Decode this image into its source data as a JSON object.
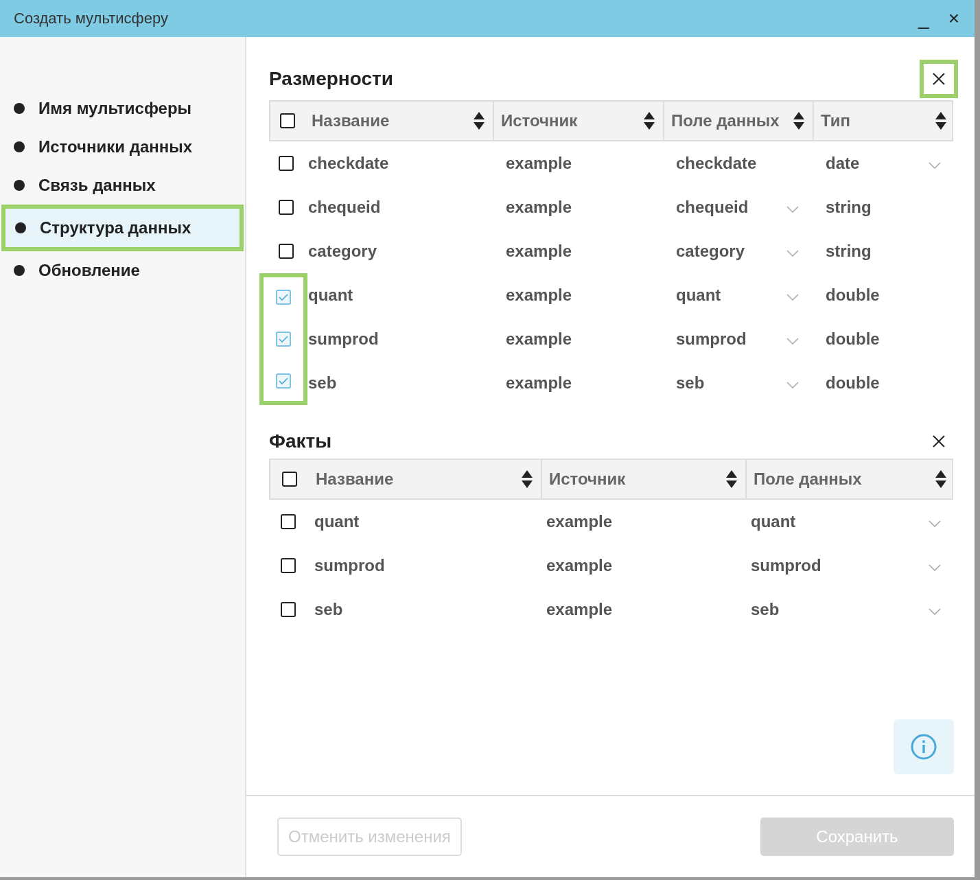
{
  "window": {
    "title": "Создать мультисферу",
    "controls": [
      "_",
      "×"
    ]
  },
  "sidebar": {
    "items": [
      {
        "label": "Имя мультисферы",
        "selected": false,
        "highlighted": false
      },
      {
        "label": "Источники данных",
        "selected": false,
        "highlighted": false
      },
      {
        "label": "Связь данных",
        "selected": false,
        "highlighted": false
      },
      {
        "label": "Структура данных",
        "selected": true,
        "highlighted": true
      },
      {
        "label": "Обновление",
        "selected": false,
        "highlighted": false
      }
    ]
  },
  "dimensions": {
    "title": "Размерности",
    "close_highlighted": true,
    "all_checked": false,
    "columns": [
      "Название",
      "Источник",
      "Поле данных",
      "Тип"
    ],
    "rows": [
      {
        "checked": false,
        "highlighted": false,
        "name": "checkdate",
        "source": "example",
        "field": "checkdate",
        "field_dropdown": false,
        "type": "date",
        "type_dropdown": true
      },
      {
        "checked": false,
        "highlighted": false,
        "name": "chequeid",
        "source": "example",
        "field": "chequeid",
        "field_dropdown": true,
        "type": "string",
        "type_dropdown": false
      },
      {
        "checked": false,
        "highlighted": false,
        "name": "category",
        "source": "example",
        "field": "category",
        "field_dropdown": true,
        "type": "string",
        "type_dropdown": false
      },
      {
        "checked": true,
        "highlighted": true,
        "name": "quant",
        "source": "example",
        "field": "quant",
        "field_dropdown": true,
        "type": "double",
        "type_dropdown": false
      },
      {
        "checked": true,
        "highlighted": true,
        "name": "sumprod",
        "source": "example",
        "field": "sumprod",
        "field_dropdown": true,
        "type": "double",
        "type_dropdown": false
      },
      {
        "checked": true,
        "highlighted": true,
        "name": "seb",
        "source": "example",
        "field": "seb",
        "field_dropdown": true,
        "type": "double",
        "type_dropdown": false
      }
    ]
  },
  "facts": {
    "title": "Факты",
    "close_highlighted": false,
    "all_checked": false,
    "columns": [
      "Название",
      "Источник",
      "Поле данных"
    ],
    "rows": [
      {
        "checked": false,
        "name": "quant",
        "source": "example",
        "field": "quant",
        "field_dropdown": true
      },
      {
        "checked": false,
        "name": "sumprod",
        "source": "example",
        "field": "sumprod",
        "field_dropdown": true
      },
      {
        "checked": false,
        "name": "seb",
        "source": "example",
        "field": "seb",
        "field_dropdown": true
      }
    ]
  },
  "buttons": [
    {
      "label": "Отменить изменения",
      "kind": "secondary",
      "disabled": true
    },
    {
      "label": "Сохранить",
      "kind": "primary",
      "disabled": true
    }
  ]
}
